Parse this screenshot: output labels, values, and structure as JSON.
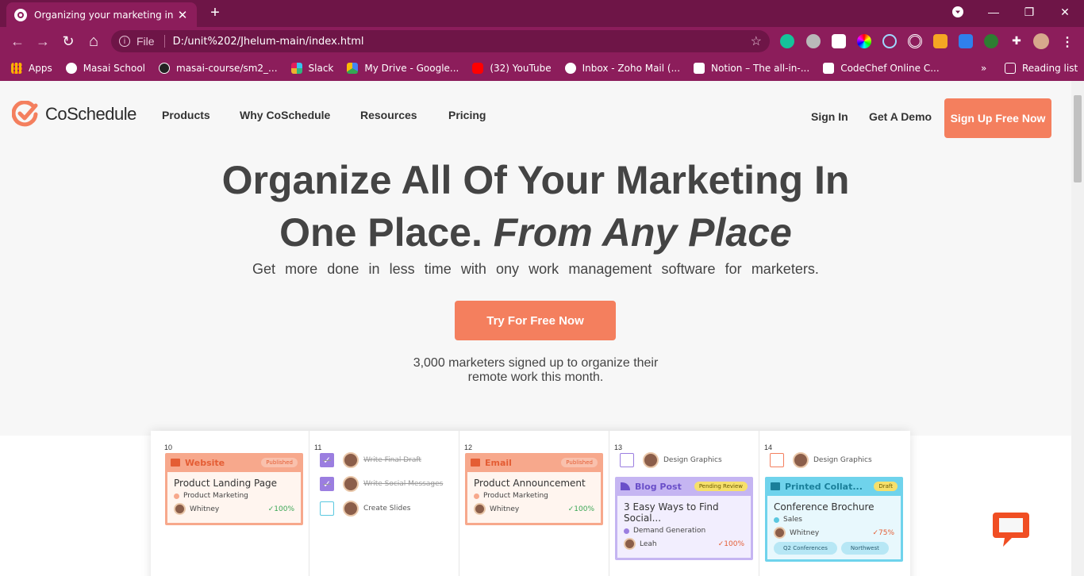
{
  "browser": {
    "tab_title": "Organizing your marketing in one",
    "close_tab": "✕",
    "new_tab": "+",
    "window_controls": [
      "—",
      "❐",
      "✕"
    ],
    "nav_back": "←",
    "nav_forward": "→",
    "reload": "↻",
    "home": "⌂",
    "info_icon": "i",
    "file_label": "File",
    "url": "D:/unit%202/Jhelum-main/index.html",
    "star": "☆",
    "menu_dots": "⋮",
    "bookmarks": [
      {
        "label": "Apps",
        "color": "#f4b400"
      },
      {
        "label": "Masai School",
        "color": "#ffffff"
      },
      {
        "label": "masai-course/sm2_...",
        "color": "#222222"
      },
      {
        "label": "Slack",
        "color": "#e01e5a"
      },
      {
        "label": "My Drive - Google...",
        "color": "#34a853"
      },
      {
        "label": "(32) YouTube",
        "color": "#ff0000"
      },
      {
        "label": "Inbox - Zoho Mail (...",
        "color": "#ffffff"
      },
      {
        "label": "Notion – The all-in-...",
        "color": "#ffffff"
      },
      {
        "label": "CodeChef Online C...",
        "color": "#ffffff"
      }
    ],
    "bookmarks_overflow": "»",
    "reading_list": "Reading list"
  },
  "site": {
    "brand": "CoSchedule",
    "nav": [
      "Products",
      "Why CoSchedule",
      "Resources",
      "Pricing"
    ],
    "sign_in": "Sign In",
    "get_demo": "Get A Demo",
    "sign_up": "Sign Up Free Now",
    "hero_line1": "Organize All Of Your Marketing In",
    "hero_line2_plain": "One Place.",
    "hero_line2_italic": "From Any Place",
    "subtitle": "Get more done in less time with ony work management software for marketers.",
    "cta": "Try For Free Now",
    "social_line1": "3,000 marketers signed up to organize their",
    "social_line2": "remote work this month."
  },
  "calendar": {
    "days": [
      "10",
      "11",
      "12",
      "13",
      "14"
    ],
    "card_website": {
      "type": "Website",
      "badge": "Published",
      "title": "Product Landing Page",
      "tag": "Product Marketing",
      "owner": "Whitney",
      "progress": "✓100%"
    },
    "tasks_11": [
      {
        "label": "Write Final Draft",
        "done": true
      },
      {
        "label": "Write Social Messages",
        "done": true
      },
      {
        "label": "Create Slides",
        "done": false
      }
    ],
    "card_email": {
      "type": "Email",
      "badge": "Published",
      "title": "Product Announcement",
      "tag": "Product Marketing",
      "owner": "Whitney",
      "progress": "✓100%"
    },
    "task_13": "Design Graphics",
    "card_blog": {
      "type": "Blog Post",
      "badge": "Pending Review",
      "title": "3 Easy Ways to Find Social...",
      "tag": "Demand Generation",
      "owner": "Leah",
      "progress": "✓100%"
    },
    "task_14": "Design Graphics",
    "card_print": {
      "type": "Printed Collat...",
      "badge": "Draft",
      "title": "Conference Brochure",
      "tag": "Sales",
      "owner": "Whitney",
      "progress": "✓75%",
      "chips": [
        "Q2 Conferences",
        "Northwest"
      ]
    }
  },
  "colors": {
    "accent": "#f47f5e",
    "browser_frame": "#8c1d5b"
  }
}
